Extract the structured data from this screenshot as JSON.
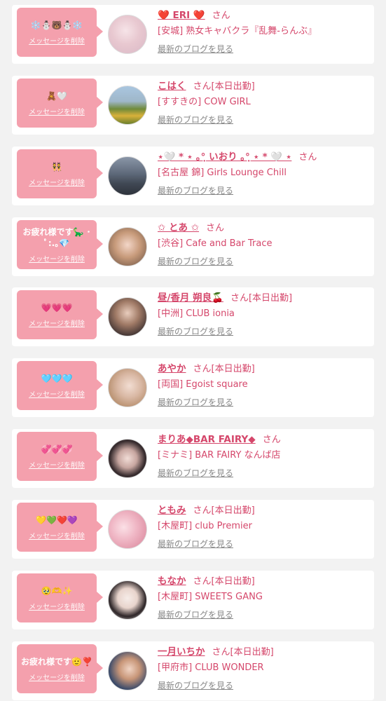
{
  "colors": {
    "accent": "#d5476b",
    "bubble": "#f4a0ad",
    "background": "#f2f2f2"
  },
  "common": {
    "delete_label": "メッセージを削除",
    "san": "さん",
    "blog_label": "最新のブログを見る"
  },
  "items": [
    {
      "message": "❄️⛄🐻⛄❄️",
      "name": "❤️ ERI ❤️",
      "status": "",
      "shop": "[安城] 熟女キャバクラ『乱舞-らんぶ』"
    },
    {
      "message": "🧸🤍",
      "name": "こはく",
      "status": "[本日出勤]",
      "shop": "[すすきの] COW GIRL"
    },
    {
      "message": "👯",
      "name": "⋆🤍 * ⋆ ｡°ฺ いおり ｡°ฺ ⋆ * 🤍 ⋆",
      "status": "",
      "shop": "[名古屋 錦] Girls Lounge Chill"
    },
    {
      "message": "お疲れ様です🦕 ･ ﾟ:.｡💎",
      "name": "✩ とあ ✩",
      "status": "",
      "shop": "[渋谷] Cafe and Bar Trace"
    },
    {
      "message": "💗💗💗",
      "name": "昼/香月 朔良🍒",
      "status": "[本日出勤]",
      "shop": "[中洲] CLUB ionia"
    },
    {
      "message": "🩵🩵🩵",
      "name": "あやか",
      "status": "[本日出勤]",
      "shop": "[両国] Egoist square"
    },
    {
      "message": "💞💞💞",
      "name": "まりあ◆BAR FAIRY◆",
      "status": "",
      "shop": "[ミナミ] BAR FAIRY なんば店"
    },
    {
      "message": "💛💚❤️💜",
      "name": "ともみ",
      "status": "[本日出勤]",
      "shop": "[木屋町] club Premier"
    },
    {
      "message": "🥹🫶✨",
      "name": "もなか",
      "status": "[本日出勤]",
      "shop": "[木屋町] SWEETS GANG"
    },
    {
      "message": "お疲れ様です🫡❣️",
      "name": "一月いちか",
      "status": "[本日出勤]",
      "shop": "[甲府市] CLUB WONDER"
    }
  ]
}
